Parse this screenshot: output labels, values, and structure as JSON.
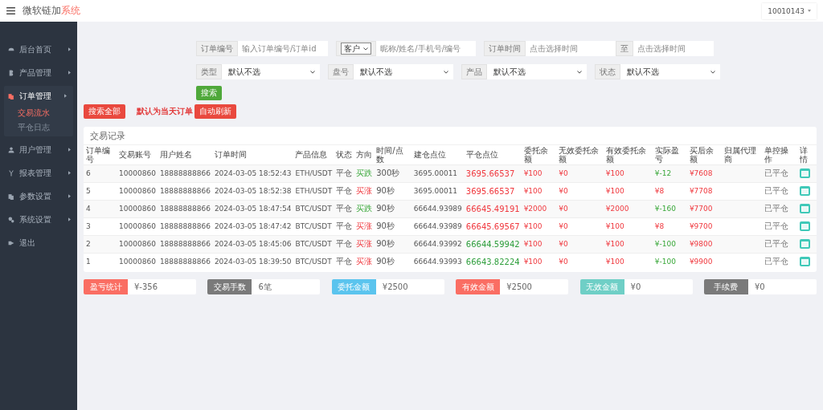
{
  "header": {
    "brand": "微软链加",
    "brand_accent": "系统",
    "user": "10010143"
  },
  "sidebar": {
    "items": [
      {
        "label": "后台首页",
        "expanded": false
      },
      {
        "label": "产品管理",
        "expanded": false
      },
      {
        "label": "订单管理",
        "expanded": true,
        "children": [
          {
            "label": "交易流水",
            "selected": true
          },
          {
            "label": "平仓日志",
            "selected": false
          }
        ]
      },
      {
        "label": "用户管理",
        "expanded": false
      },
      {
        "label": "报表管理",
        "expanded": false
      },
      {
        "label": "参数设置",
        "expanded": false
      },
      {
        "label": "系统设置",
        "expanded": false
      },
      {
        "label": "退出",
        "expanded": false
      }
    ]
  },
  "filters": {
    "row1": [
      {
        "kind": "input",
        "label": "订单编号",
        "placeholder": "输入订单编号/订单id"
      },
      {
        "kind": "select-input",
        "option": "客户",
        "placeholder": "昵称/姓名/手机号/编号"
      },
      {
        "kind": "input",
        "label": "订单时间",
        "placeholder": "点击选择时间"
      },
      {
        "kind": "input",
        "label": "至",
        "placeholder": "点击选择时间"
      }
    ],
    "row2": [
      {
        "kind": "select",
        "label": "类型",
        "value": "默认不选"
      },
      {
        "kind": "select",
        "label": "盘号",
        "value": "默认不选"
      },
      {
        "kind": "select",
        "label": "产品",
        "value": "默认不选"
      },
      {
        "kind": "select",
        "label": "状态",
        "value": "默认不选"
      }
    ],
    "search_button": "搜索"
  },
  "actions": {
    "search_all": "搜索全部",
    "note": "默认为当天订单",
    "auto_refresh": "自动刷新"
  },
  "table": {
    "title": "交易记录",
    "columns": [
      "订单编号",
      "交易账号",
      "用户姓名",
      "订单时间",
      "产品信息",
      "状态",
      "方向",
      "时间/点数",
      "建仓点位",
      "平仓点位",
      "委托余额",
      "无效委托余额",
      "有效委托余额",
      "实际盈亏",
      "买后余额",
      "归属代理商",
      "单控操作",
      "详情"
    ],
    "rows": [
      {
        "id": "6",
        "account": "10000860",
        "user": "18888888866",
        "time": "2024-03-05 18:52:43",
        "product": "ETH/USDT",
        "status": "平仓",
        "direction": {
          "text": "买跌",
          "kind": "down"
        },
        "period": "300秒",
        "open": "3695.00011",
        "close": {
          "text": "3695.66537",
          "kind": "up"
        },
        "entrust": "¥100",
        "invalid": "¥0",
        "valid": "¥100",
        "profit": {
          "text": "¥-12",
          "kind": "loss"
        },
        "balance": "¥7608",
        "action": "已平仓"
      },
      {
        "id": "5",
        "account": "10000860",
        "user": "18888888866",
        "time": "2024-03-05 18:52:38",
        "product": "ETH/USDT",
        "status": "平仓",
        "direction": {
          "text": "买涨",
          "kind": "up"
        },
        "period": "90秒",
        "open": "3695.00011",
        "close": {
          "text": "3695.66537",
          "kind": "up"
        },
        "entrust": "¥100",
        "invalid": "¥0",
        "valid": "¥100",
        "profit": {
          "text": "¥8",
          "kind": "gain"
        },
        "balance": "¥7708",
        "action": "已平仓"
      },
      {
        "id": "4",
        "account": "10000860",
        "user": "18888888866",
        "time": "2024-03-05 18:47:54",
        "product": "BTC/USDT",
        "status": "平仓",
        "direction": {
          "text": "买跌",
          "kind": "down"
        },
        "period": "90秒",
        "open": "66644.93989",
        "close": {
          "text": "66645.49191",
          "kind": "up"
        },
        "entrust": "¥2000",
        "invalid": "¥0",
        "valid": "¥2000",
        "profit": {
          "text": "¥-160",
          "kind": "loss"
        },
        "balance": "¥7700",
        "action": "已平仓"
      },
      {
        "id": "3",
        "account": "10000860",
        "user": "18888888866",
        "time": "2024-03-05 18:47:42",
        "product": "BTC/USDT",
        "status": "平仓",
        "direction": {
          "text": "买涨",
          "kind": "up"
        },
        "period": "90秒",
        "open": "66644.93989",
        "close": {
          "text": "66645.69567",
          "kind": "up"
        },
        "entrust": "¥100",
        "invalid": "¥0",
        "valid": "¥100",
        "profit": {
          "text": "¥8",
          "kind": "gain"
        },
        "balance": "¥9700",
        "action": "已平仓"
      },
      {
        "id": "2",
        "account": "10000860",
        "user": "18888888866",
        "time": "2024-03-05 18:45:06",
        "product": "BTC/USDT",
        "status": "平仓",
        "direction": {
          "text": "买涨",
          "kind": "up"
        },
        "period": "90秒",
        "open": "66644.93992",
        "close": {
          "text": "66644.59942",
          "kind": "down"
        },
        "entrust": "¥100",
        "invalid": "¥0",
        "valid": "¥100",
        "profit": {
          "text": "¥-100",
          "kind": "loss"
        },
        "balance": "¥9800",
        "action": "已平仓"
      },
      {
        "id": "1",
        "account": "10000860",
        "user": "18888888866",
        "time": "2024-03-05 18:39:50",
        "product": "BTC/USDT",
        "status": "平仓",
        "direction": {
          "text": "买涨",
          "kind": "up"
        },
        "period": "90秒",
        "open": "66644.93993",
        "close": {
          "text": "66643.82224",
          "kind": "down"
        },
        "entrust": "¥100",
        "invalid": "¥0",
        "valid": "¥100",
        "profit": {
          "text": "¥-100",
          "kind": "loss"
        },
        "balance": "¥9900",
        "action": "已平仓"
      }
    ]
  },
  "summary": [
    {
      "label": "盈亏统计",
      "value": "¥-356",
      "color": "#fa6e63"
    },
    {
      "label": "交易手数",
      "value": "6笔",
      "color": "#7a7a7a"
    },
    {
      "label": "委托金额",
      "value": "¥2500",
      "color": "#5bc4ee"
    },
    {
      "label": "有效金额",
      "value": "¥2500",
      "color": "#fa6e63"
    },
    {
      "label": "无效金额",
      "value": "¥0",
      "color": "#6fcfc6"
    },
    {
      "label": "手续费",
      "value": "¥0",
      "color": "#7a7a7a"
    }
  ]
}
